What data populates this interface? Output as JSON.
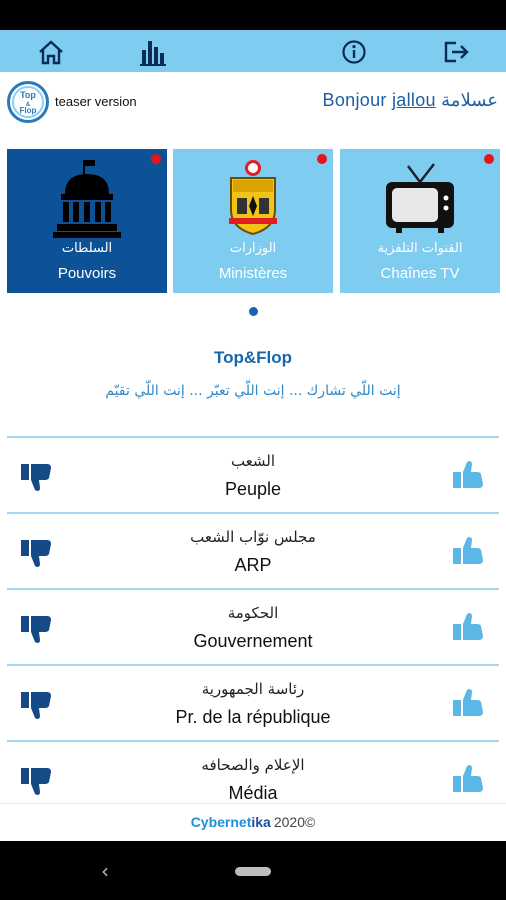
{
  "toolbar": {
    "icons": [
      "home-icon",
      "stats-icon",
      "info-icon",
      "logout-icon"
    ]
  },
  "header": {
    "logo_text": "Top & Flop",
    "teaser": "teaser version",
    "greeting_prefix": "Bonjour ",
    "username": "jallou",
    "greeting_ar": " عسلامة"
  },
  "categories": [
    {
      "ar": "السلطات",
      "fr": "Pouvoirs",
      "icon": "parliament-icon",
      "bg": "#0d5296",
      "active": true
    },
    {
      "ar": "الوزارات",
      "fr": "Ministères",
      "icon": "tunisia-emblem-icon",
      "bg": "#7ecdf0",
      "active": false
    },
    {
      "ar": "القنوات التلفزية",
      "fr": "Chaînes TV",
      "icon": "tv-icon",
      "bg": "#7ecdf0",
      "active": false
    }
  ],
  "section": {
    "title": "Top&Flop",
    "tagline": "إنت اللّي تشارك ... إنت اللّي تعبّر ... إنت اللّي تقيّم"
  },
  "items": [
    {
      "ar": "الشعب",
      "fr": "Peuple"
    },
    {
      "ar": "مجلس نوّاب الشعب",
      "fr": "ARP"
    },
    {
      "ar": "الحكومة",
      "fr": "Gouvernement"
    },
    {
      "ar": "رئاسة الجمهورية",
      "fr": "Pr. de la république"
    },
    {
      "ar": "الإعلام والصحافه",
      "fr": "Média"
    }
  ],
  "footer": {
    "brand_a": "Cybernet",
    "brand_b": "ika",
    "year": "2020©"
  },
  "colors": {
    "toolbar": "#7ecdf0",
    "accent": "#0d5296",
    "thumb_up": "#5bb8e6",
    "thumb_down": "#164a86",
    "badge": "#e8141b"
  }
}
